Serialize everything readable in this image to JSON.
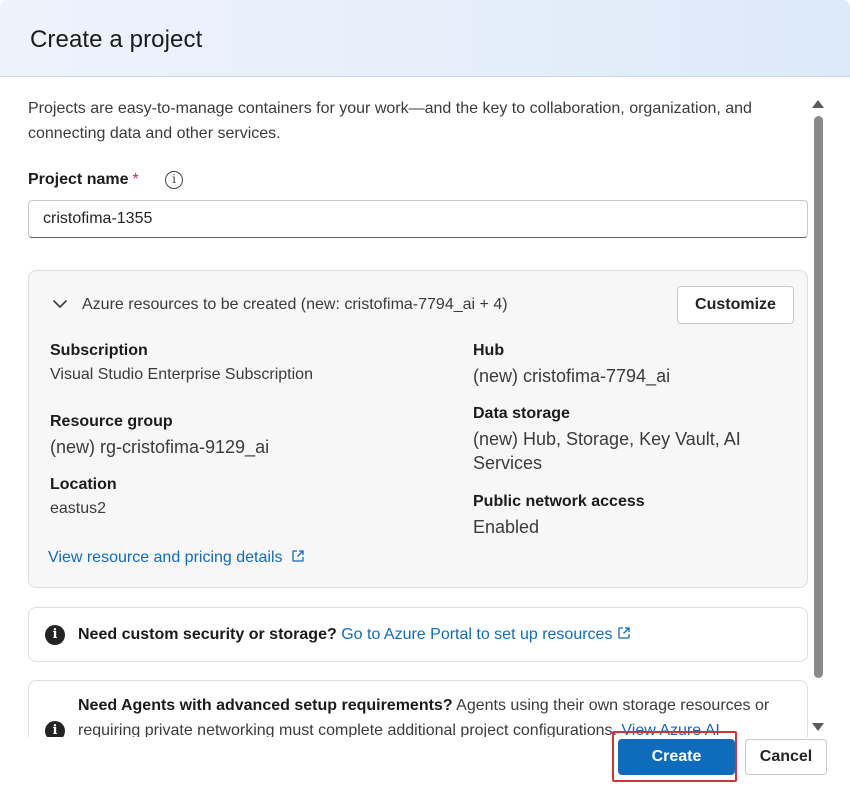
{
  "dialog": {
    "title": "Create a project",
    "intro": "Projects are easy-to-manage containers for your work—and the key to collaboration, organization, and connecting data and other services."
  },
  "project_name": {
    "label": "Project name",
    "required_mark": "*",
    "info_icon": "info-icon",
    "value": "cristofima-1355"
  },
  "resources": {
    "title": "Azure resources to be created (new: cristofima-7794_ai + 4)",
    "customize_label": "Customize",
    "subscription_label": "Subscription",
    "subscription_value": "Visual Studio Enterprise Subscription",
    "resource_group_label": "Resource group",
    "resource_group_value": "(new) rg-cristofima-9129_ai",
    "location_label": "Location",
    "location_value": "eastus2",
    "hub_label": "Hub",
    "hub_value": "(new) cristofima-7794_ai",
    "data_storage_label": "Data storage",
    "data_storage_value": "(new) Hub, Storage, Key Vault, AI Services",
    "public_network_label": "Public network access",
    "public_network_value": "Enabled",
    "pricing_link": "View resource and pricing details"
  },
  "notice_security": {
    "bold": "Need custom security or storage?",
    "link": "Go to Azure Portal to set up resources"
  },
  "notice_agents": {
    "bold": "Need Agents with advanced setup requirements?",
    "text": " Agents using their own storage resources or requiring private networking must complete additional project configurations. ",
    "link": "View Azure AI"
  },
  "footer": {
    "create_label": "Create",
    "cancel_label": "Cancel"
  },
  "colors": {
    "primary": "#0f6cbd",
    "highlight": "#d13438",
    "required": "#c4314b"
  }
}
